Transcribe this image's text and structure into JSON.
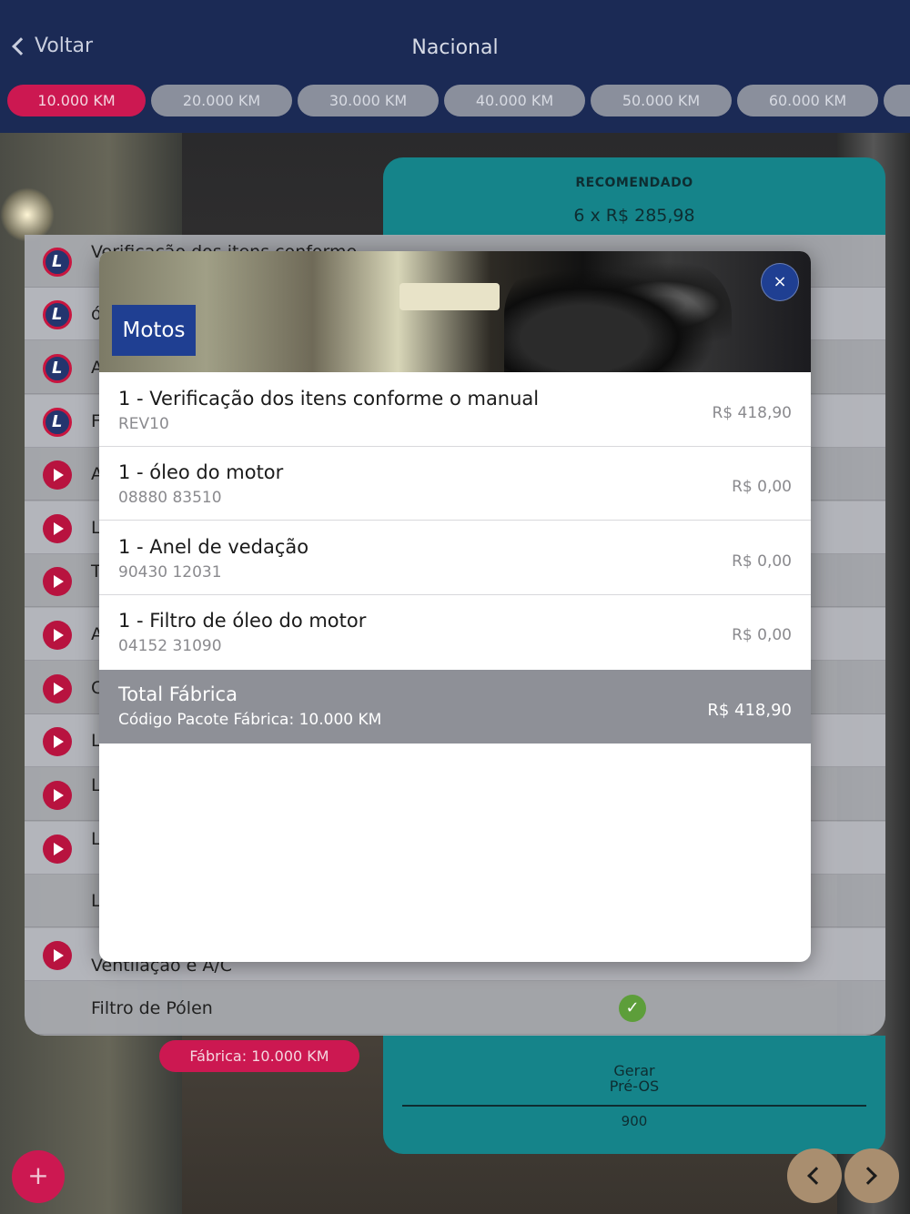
{
  "header": {
    "back_label": "Voltar",
    "title": "Nacional",
    "tabs": [
      "10.000 KM",
      "20.000 KM",
      "30.000 KM",
      "40.000 KM",
      "50.000 KM",
      "60.000 KM"
    ],
    "active_tab": "10.000 KM"
  },
  "recommended": {
    "label": "RECOMENDADO",
    "value": "6 x R$ 285,98",
    "gerar_line1": "Gerar",
    "gerar_line2": "Pré-OS",
    "number": "900"
  },
  "list": {
    "rows": [
      {
        "icon": "logo",
        "text": "Verificação dos itens conforme"
      },
      {
        "icon": "logo",
        "text": "ó"
      },
      {
        "icon": "logo",
        "text": "A"
      },
      {
        "icon": "logo",
        "text": "F"
      },
      {
        "icon": "play",
        "text": "A"
      },
      {
        "icon": "play",
        "text": "L"
      },
      {
        "icon": "play",
        "text": "T"
      },
      {
        "icon": "play",
        "text": "A"
      },
      {
        "icon": "play",
        "text": "C"
      },
      {
        "icon": "play",
        "text": "L"
      },
      {
        "icon": "play",
        "text": "L"
      },
      {
        "icon": "play",
        "text": "L"
      },
      {
        "icon": "none",
        "text": "L"
      },
      {
        "icon": "play",
        "text": "Ventilação e A/C"
      },
      {
        "icon": "none",
        "text": "Filtro de Pólen"
      }
    ],
    "fabrica_button": "Fábrica: 10.000 KM",
    "add_button": "+"
  },
  "modal": {
    "tag": "Motos",
    "close": "×",
    "items": [
      {
        "name": "1 - Verificação dos itens conforme o manual",
        "code": "REV10",
        "price": "R$ 418,90"
      },
      {
        "name": "1 - óleo do motor",
        "code": "08880 83510",
        "price": "R$ 0,00"
      },
      {
        "name": "1 - Anel de vedação",
        "code": "90430 12031",
        "price": "R$ 0,00"
      },
      {
        "name": "1 - Filtro de óleo do motor",
        "code": "04152 31090",
        "price": "R$ 0,00"
      }
    ],
    "total": {
      "name": "Total Fábrica",
      "code": "Código Pacote Fábrica: 10.000 KM",
      "price": "R$ 418,90"
    }
  }
}
